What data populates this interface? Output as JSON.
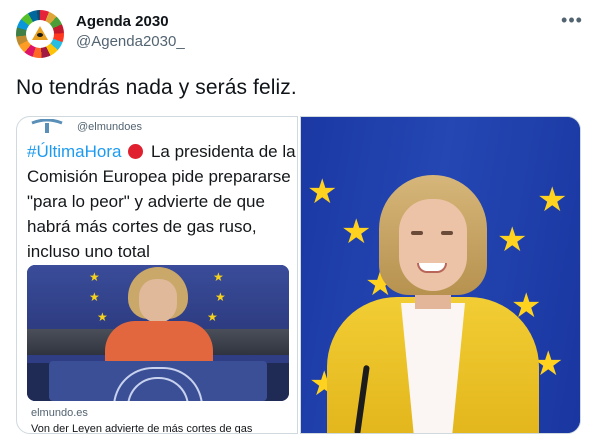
{
  "tweet": {
    "display_name": "Agenda 2030",
    "handle": "@Agenda2030_",
    "more_icon": "more-horizontal-icon",
    "text": "No tendrás nada y serás feliz."
  },
  "media_left": {
    "source_handle": "@elmundoes",
    "hashtag": "#ÚltimaHora",
    "headline": "La presidenta de la Comisión Europea pide prepararse \"para lo peor\" y advierte de que habrá más cortes de gas ruso, incluso uno total",
    "site": "elmundo.es",
    "link_title": "Von der Leyen advierte de más cortes de gas"
  },
  "colors": {
    "hashtag": "#1d9bf0",
    "eu_blue": "#1b38a3",
    "eu_star": "#ffd21f",
    "jacket": "#f2cd34"
  }
}
